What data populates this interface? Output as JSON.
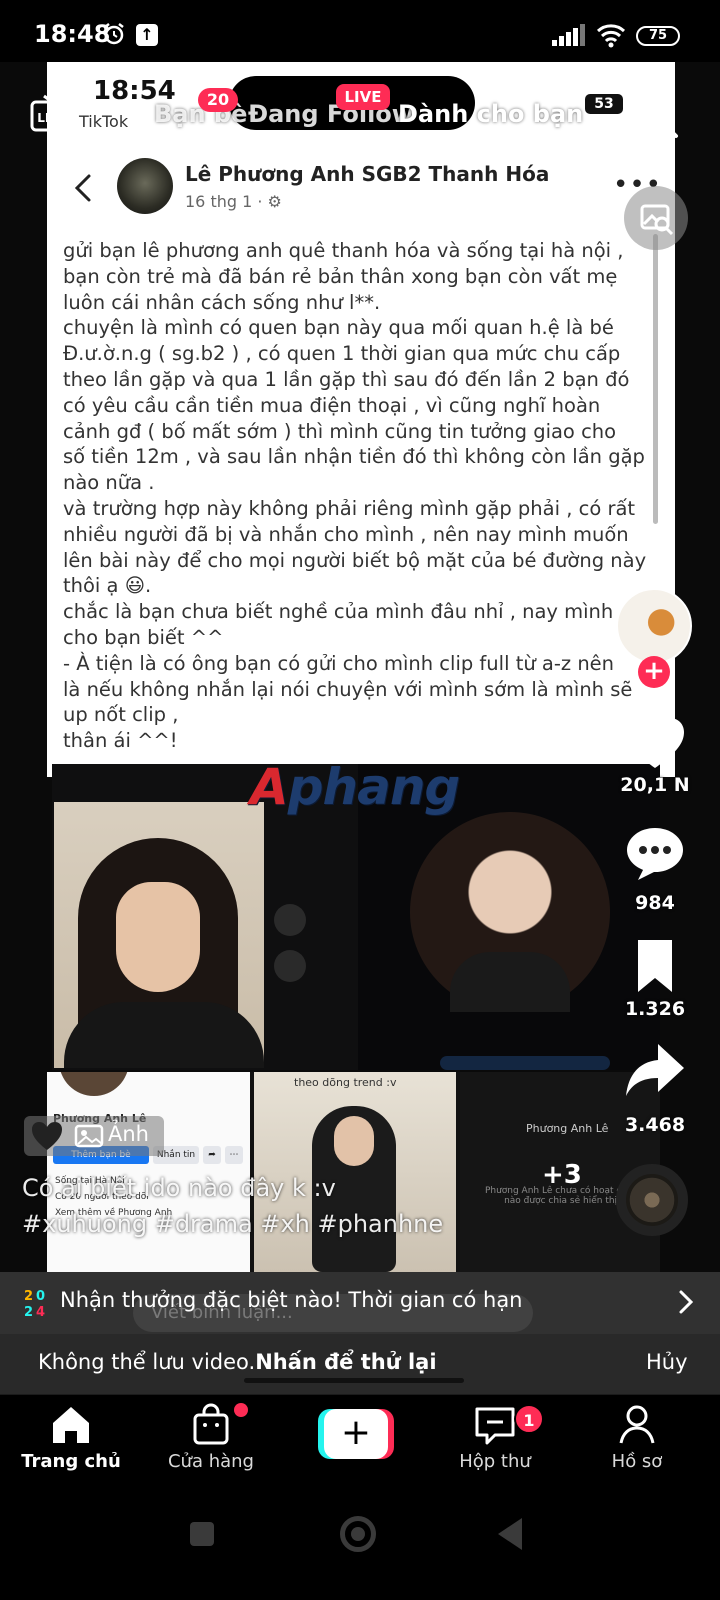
{
  "status_bar": {
    "time": "18:48",
    "battery": "75"
  },
  "top_nav": {
    "live_label": "LIVE",
    "tabs": [
      {
        "label": "Bạn bè",
        "badge": "20"
      },
      {
        "label": "Đang Follow",
        "badge": "LIVE"
      },
      {
        "label": "Dành cho bạn"
      }
    ],
    "accent_color": "#fe2c55"
  },
  "screenshot_post": {
    "status_time": "18:54",
    "status_app": "TikTok",
    "status_battery": "53",
    "author": "Lê Phương Anh SGB2 Thanh Hóa",
    "date": "16 thg 1 ·",
    "more_label": "•••",
    "body_lines": [
      "gửi bạn lê phương anh quê thanh hóa và sống tại hà nội ,",
      "bạn còn trẻ mà đã bán rẻ bản thân xong bạn còn vất mẹ",
      "luôn cái nhân cách sống như l**.",
      "chuyện là mình có quen bạn này qua mối quan h.ệ là bé",
      "Đ.ư.ờ.n.g ( sg.b2 ) , có quen 1 thời gian qua mức chu cấp",
      "theo lần gặp và qua 1 lần gặp thì sau đó đến lần 2 bạn đó",
      "có yêu cầu cần tiền mua điện thoại , vì cũng nghĩ hoàn",
      "cảnh gđ ( bố mất sớm ) thì mình cũng tin tưởng giao cho",
      "số tiền 12m , và sau lần nhận tiền đó thì không còn lần gặp",
      "nào nữa .",
      "và trường hợp này không phải riêng mình gặp phải , có rất",
      "nhiều người đã bị và nhắn cho mình , nên nay mình muốn",
      "lên bài này để cho mọi người biết bộ mặt của bé đường này",
      "thôi ạ 😃.",
      "chắc là bạn chưa biết nghề của mình đâu nhỉ , nay mình s",
      "cho bạn biết ^^",
      "- À tiện là có ông bạn có gửi cho mình clip full từ a-z nên",
      "là nếu không nhắn lại nói chuyện với mình sớm là mình sẽ",
      "up nốt clip ,",
      "thân ái ^^!"
    ]
  },
  "watermark": {
    "prefix": "A",
    "text": "phang"
  },
  "collage": {
    "profile_name": "Phương Anh Lê",
    "add_friend": "Thêm bạn bè",
    "message": "Nhắn tin",
    "info_lines": [
      "Sống tại Hà Nội",
      "Có 20 người theo dõi",
      "Xem thêm về Phương Anh"
    ],
    "mid_caption": "theo dõng trend :v",
    "right_name": "Phương Anh Lê",
    "more_count": "+3",
    "right_sub": "Phương Anh Lê chưa có hoạt động nào được chia sẻ hiển thị."
  },
  "actions": {
    "likes": "20,1 N",
    "comments": "984",
    "saves": "1.326",
    "shares": "3.468"
  },
  "caption": {
    "photo_chip": "Ảnh",
    "text": "Có ai biết ido nào đây k :v",
    "hashtags": "#xuhuong #drama #xh #phanhne"
  },
  "promo": {
    "text": "Nhận thưởng đặc biệt nào! Thời gian có hạn"
  },
  "comment": {
    "placeholder": "Viết bình luận..."
  },
  "toast": {
    "message": "Không thể lưu video.",
    "action": "Nhấn để thử lại",
    "cancel": "Hủy"
  },
  "bottom_nav": {
    "home": "Trang chủ",
    "shop": "Cửa hàng",
    "create": "+",
    "inbox": "Hộp thư",
    "inbox_badge": "1",
    "profile": "Hồ sơ"
  }
}
